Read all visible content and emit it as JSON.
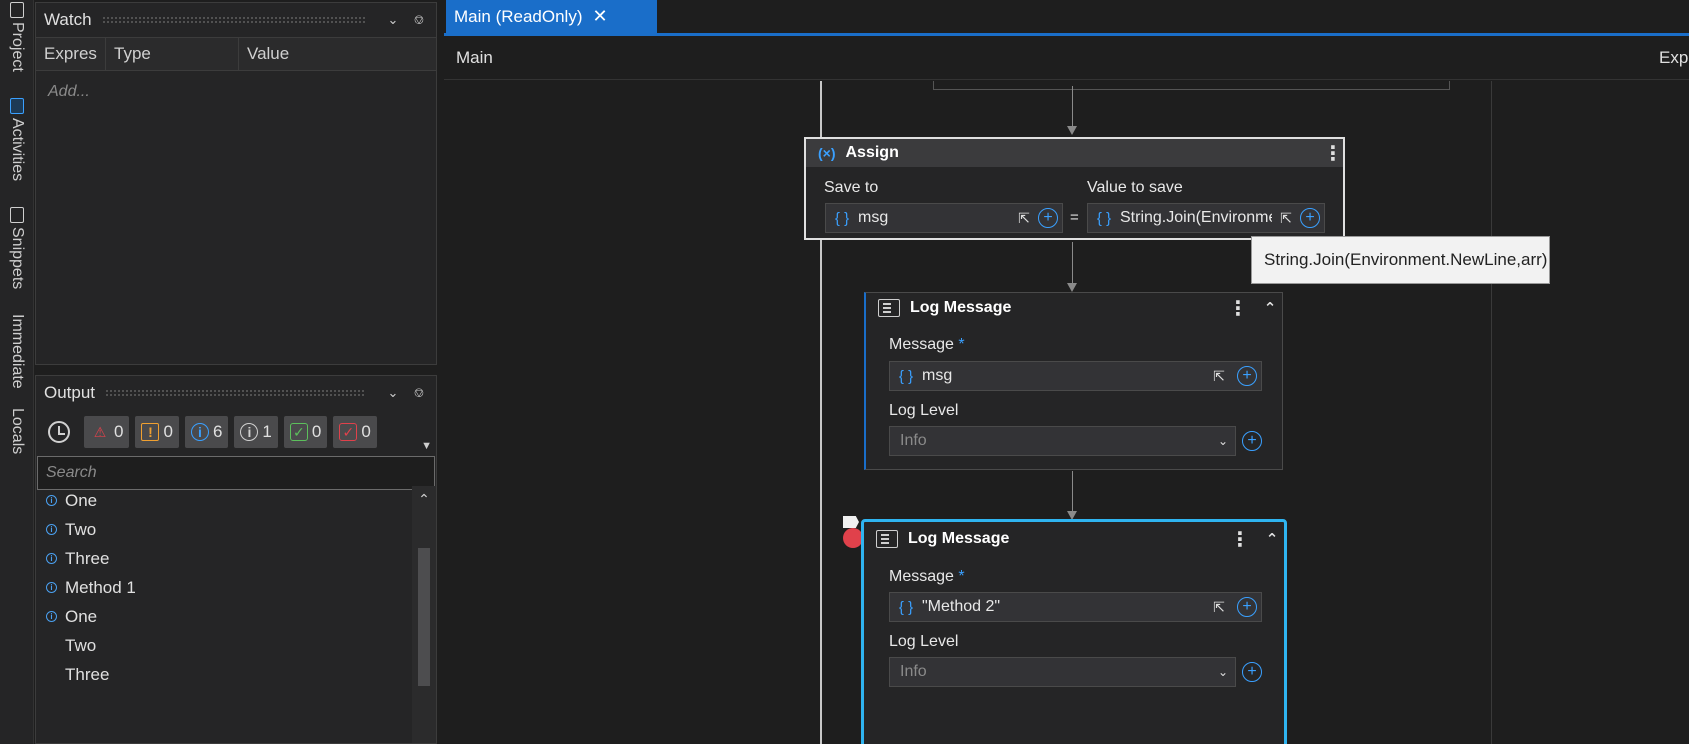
{
  "side_tabs": [
    {
      "label": "Project",
      "icon": "file-icon"
    },
    {
      "label": "Activities",
      "icon": "activities-icon"
    },
    {
      "label": "Snippets",
      "icon": "snippets-icon"
    },
    {
      "label": "Immediate",
      "icon": ""
    },
    {
      "label": "Locals",
      "icon": ""
    }
  ],
  "watch": {
    "title": "Watch",
    "columns": [
      "Expres",
      "Type",
      "Value"
    ],
    "add_placeholder": "Add..."
  },
  "output": {
    "title": "Output",
    "badges": [
      {
        "icon": "error-icon",
        "count": "0",
        "color": "#e0414b"
      },
      {
        "icon": "warning-icon",
        "count": "0",
        "color": "#f0a030"
      },
      {
        "icon": "info-icon",
        "count": "6",
        "color": "#3aa0ff"
      },
      {
        "icon": "trace-icon",
        "count": "1",
        "color": "#d0d0d0"
      },
      {
        "icon": "success-icon",
        "count": "0",
        "color": "#5cc05c"
      },
      {
        "icon": "failed-icon",
        "count": "0",
        "color": "#e0414b"
      }
    ],
    "search_placeholder": "Search",
    "lines": [
      {
        "text": "One",
        "info": true
      },
      {
        "text": "Two",
        "info": true
      },
      {
        "text": "Three",
        "info": true
      },
      {
        "text": "Method 1",
        "info": true
      },
      {
        "text": "One",
        "info": true
      },
      {
        "text": "Two",
        "info": false
      },
      {
        "text": "Three",
        "info": false
      }
    ]
  },
  "editor": {
    "tab_label": "Main (ReadOnly)",
    "breadcrumb": "Main",
    "expand_all": "Expand All"
  },
  "assign": {
    "title": "Assign",
    "save_to_label": "Save to",
    "save_to_value": "msg",
    "value_label": "Value to save",
    "value_value": "String.Join(Environmer",
    "equals": "="
  },
  "tooltip": "String.Join(Environment.NewLine,arr)",
  "log1": {
    "title": "Log Message",
    "message_label": "Message",
    "required": "*",
    "message_value": "msg",
    "level_label": "Log Level",
    "level_value": "Info"
  },
  "log2": {
    "title": "Log Message",
    "message_label": "Message",
    "required": "*",
    "message_value": "\"Method 2\"",
    "level_label": "Log Level",
    "level_value": "Info"
  },
  "colors": {
    "accent": "#1a6ec9",
    "selected_border": "#2fb4f0",
    "breakpoint": "#e0414b"
  }
}
